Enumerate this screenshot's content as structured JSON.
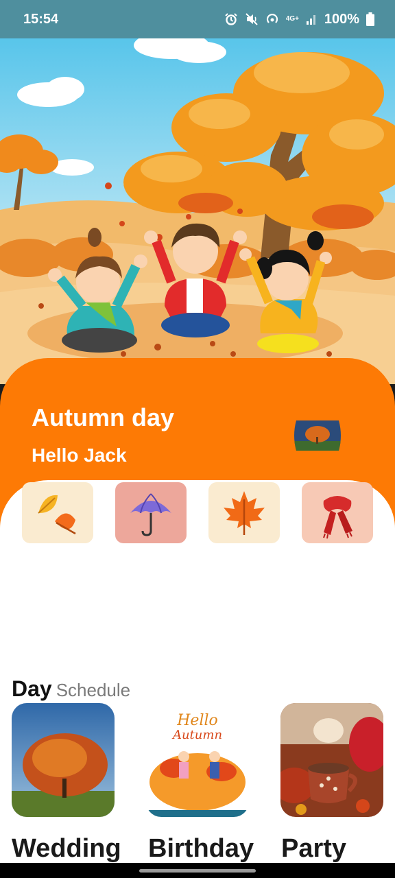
{
  "status_bar": {
    "time": "15:54",
    "network": "4G+",
    "battery": "100%",
    "icons": [
      "alarm-icon",
      "mute-icon",
      "hotspot-icon",
      "signal-icon",
      "battery-icon"
    ]
  },
  "hero": {
    "image": "autumn-kids-illustration"
  },
  "header": {
    "title": "Autumn day",
    "subtitle": "Hello Jack",
    "thumbnail": "autumn-tree-thumbnail"
  },
  "categories": [
    {
      "icon": "falling-leaves-icon",
      "bg": "#faebd0"
    },
    {
      "icon": "umbrella-icon",
      "bg": "#eda79b"
    },
    {
      "icon": "maple-leaf-icon",
      "bg": "#faebd0"
    },
    {
      "icon": "scarf-icon",
      "bg": "#f7c9b5"
    }
  ],
  "schedule": {
    "title_bold": "Day",
    "title_light": "Schedule",
    "cards": [
      {
        "label": "Wedding",
        "image": "autumn-tree-photo"
      },
      {
        "label": "Birthday",
        "image": "hello-autumn-poster"
      },
      {
        "label": "Party",
        "image": "autumn-coffee-photo"
      }
    ]
  },
  "colors": {
    "accent": "#fd7a05",
    "status_bar": "#4f8f9e"
  }
}
